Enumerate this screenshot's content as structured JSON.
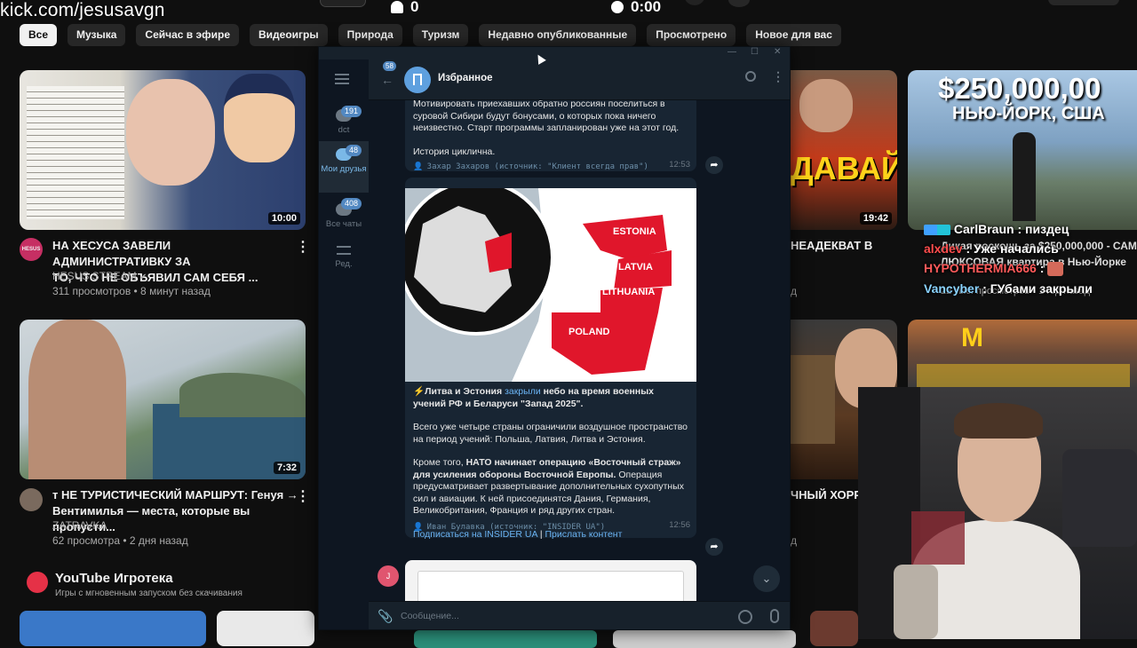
{
  "overlay": {
    "channel_url": "kick.com/jesusavgn",
    "viewers_count": "0",
    "timer": "0:00"
  },
  "chips": [
    "Все",
    "Музыка",
    "Сейчас в эфире",
    "Видеоигры",
    "Природа",
    "Туризм",
    "Недавно опубликованные",
    "Просмотрено",
    "Новое для вас"
  ],
  "videos": [
    {
      "title_line1": "НА ХЕСУСА ЗАВЕЛИ АДМИНИСТРАТИВКУ ЗА",
      "title_line2": "ТО, ЧТО НЕ ОБЪЯВИЛ САМ СЕБЯ ...",
      "channel": "HESUS STREAM",
      "meta": "311 просмотров • 8 минут назад",
      "duration": "10:00",
      "avatar_text": "HESUS"
    },
    {
      "title_line1": "т НЕ ТУРИСТИЧЕСКИЙ МАРШРУТ: Генуя →",
      "title_line2": "Вентимилья — места, которые вы пропусти...",
      "channel": "ZATRAVKA",
      "meta": "62 просмотра • 2 дня назад",
      "duration": "7:32"
    },
    {
      "title_partial": "НЕАДЕКВАТ В",
      "duration": "19:42",
      "thumb_text": "ДАВАЙ"
    },
    {
      "title_partial": "ЧНЫЙ ХОРРО"
    },
    {
      "title_line1": "Дикая роскошь за $250,000,000 - САМ",
      "title_line2": "ЛЮКСОВАЯ квартира в Нью-Йорке",
      "meta": "22 тыс. просмотров • 1 год назад",
      "thumb_line1": "$250,000,00",
      "thumb_line2": "НЬЮ-ЙОРК, США"
    }
  ],
  "playables": {
    "title": "YouTube Игротека",
    "subtitle": "Игры с мгновенным запуском без скачивания"
  },
  "telegram": {
    "chat_title": "Избранное",
    "unread_back": "58",
    "sidebar": [
      {
        "label": "dct",
        "badge": "191"
      },
      {
        "label": "Мои друзья",
        "badge": "48"
      },
      {
        "label": "Все чаты",
        "badge": "408"
      },
      {
        "label": "Ред."
      }
    ],
    "msg1": {
      "text1": "Мотивировать приехавших обратно россиян поселиться в суровой Сибири будут бонусами, о которых пока ничего неизвестно. Старт программы запланирован уже на этот год.",
      "text2": "История циклична.",
      "forward": "Захар Захаров (источник: \"Клиент всегда прав\")",
      "time": "12:53"
    },
    "map_labels": [
      "ESTONIA",
      "LATVIA",
      "LITHUANIA",
      "POLAND"
    ],
    "msg2": {
      "lead_pre": "⚡Литва и Эстония ",
      "lead_link": "закрыли",
      "lead_post": " небо на время военных учений РФ и Беларуси \"Запад 2025\".",
      "p2": "Всего уже четыре страны ограничили воздушное пространство на период учений: Польша, Латвия, Литва и Эстония.",
      "p3_pre": "Кроме того, ",
      "p3_bold": "НАТО начинает операцию «Восточный страж» для усиления обороны Восточной Европы.",
      "p3_post": " Операция предусматривает развертывание дополнительных сухопутных сил и авиации. К ней присоединятся Дания, Германия, Великобритания, Франция и ряд других стран.",
      "sub_link": "Подписаться на INSIDER UA",
      "separator": "|",
      "send_link": "Прислать контент",
      "forward": "Иван Булавка (источник: \"INSIDER UA\")",
      "time": "12:56"
    },
    "avatar_letter": "J",
    "input_placeholder": "Сообщение..."
  },
  "stream_chat": [
    {
      "user": "CarlBraun",
      "text": " : пиздец",
      "color": "#ffffff"
    },
    {
      "user": "alxdev",
      "text": " : Уже начались",
      "color": "#ff4d4d"
    },
    {
      "user": "HYPOTHERMIA666",
      "text": " : ",
      "color": "#ff5a5a"
    },
    {
      "user": "Vancyber",
      "text": " : ГУбами закрыли",
      "color": "#8ad3ff"
    }
  ]
}
